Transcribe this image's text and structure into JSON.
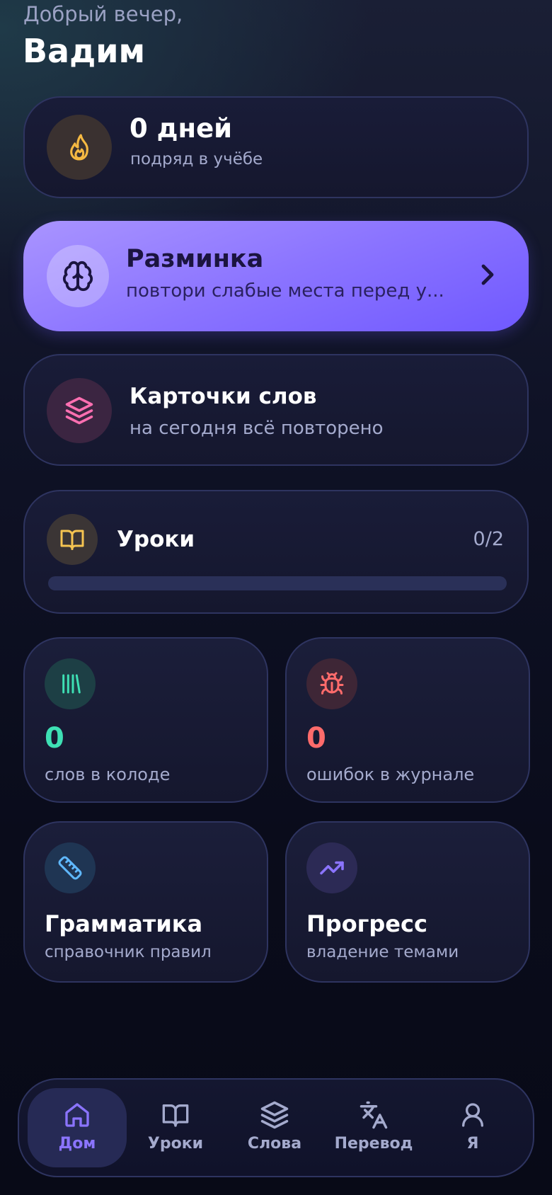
{
  "header": {
    "greeting": "Добрый вечер,",
    "user_name": "Вадим"
  },
  "streak": {
    "title": "0 дней",
    "subtitle": "подряд в учёбе",
    "icon": "flame-icon"
  },
  "warmup": {
    "title": "Разминка",
    "subtitle": "повтори слабые места перед у...",
    "icon": "brain-icon"
  },
  "flashcards": {
    "title": "Карточки слов",
    "subtitle": "на сегодня всё повторено",
    "icon": "layers-icon"
  },
  "lessons": {
    "title": "Уроки",
    "counter": "0/2",
    "progress": 0,
    "icon": "book-icon"
  },
  "stats": {
    "words": {
      "value": "0",
      "label": "слов в колоде",
      "color": "#3ee0b4",
      "icon": "library-icon"
    },
    "errors": {
      "value": "0",
      "label": "ошибок в журнале",
      "color": "#ff6b6b",
      "icon": "bug-icon"
    }
  },
  "features": {
    "grammar": {
      "title": "Грамматика",
      "subtitle": "справочник правил",
      "icon": "ruler-icon"
    },
    "progress": {
      "title": "Прогресс",
      "subtitle": "владение темами",
      "icon": "trending-up-icon"
    }
  },
  "nav": {
    "items": [
      {
        "label": "Дом",
        "icon": "home-icon",
        "active": true
      },
      {
        "label": "Уроки",
        "icon": "book-icon",
        "active": false
      },
      {
        "label": "Слова",
        "icon": "layers-icon",
        "active": false
      },
      {
        "label": "Перевод",
        "icon": "translate-icon",
        "active": false
      },
      {
        "label": "Я",
        "icon": "user-icon",
        "active": false
      }
    ]
  },
  "colors": {
    "accent": "#8b74ff",
    "flame": "#f5b942",
    "pink": "#ff6fb1",
    "amber": "#f5c451",
    "teal": "#3ee0b4",
    "red": "#ff6b6b",
    "sky": "#5fb8ff"
  }
}
